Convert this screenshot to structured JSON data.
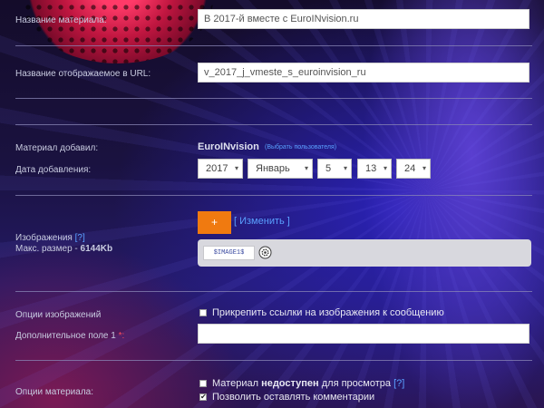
{
  "form": {
    "title_label": "Название материала:",
    "title_value": "В 2017-й вместе с EuroINvision.ru",
    "url_label": "Название отображаемое в URL:",
    "url_value": "v_2017_j_vmeste_s_euroinvision_ru",
    "added_by_label": "Материал добавил:",
    "added_by_value": "EuroINvision",
    "choose_user_link": "(Выбрать пользователя)",
    "date_label": "Дата добавления:",
    "date": {
      "year": "2017",
      "month": "Январь",
      "day": "5",
      "hour": "13",
      "minute": "24"
    },
    "images_label": "Изображения",
    "images_help": "[?]",
    "max_size_prefix": "Макс. размер - ",
    "max_size_value": "6144Kb",
    "add_button_label": "+",
    "change_link": "[ Изменить ]",
    "image_tag": "$IMAGE1$",
    "image_options_label": "Опции изображений",
    "attach_links_label": "Прикрепить ссылки на изображения к сообщению",
    "extra_field_label": "Дополнительное поле 1",
    "required_mark": "*:",
    "extra_field_value": "",
    "material_options_label": "Опции материала:",
    "unavailable_prefix": "Материал ",
    "unavailable_bold": "недоступен",
    "unavailable_suffix": " для просмотра ",
    "unavailable_help": "[?]",
    "allow_comments_label": "Позволить оставлять комментарии",
    "attach_links_checked": false,
    "unavailable_checked": false,
    "allow_comments_checked": true
  },
  "colors": {
    "accent_orange": "#f07a10",
    "link_blue": "#5aa0ff"
  }
}
